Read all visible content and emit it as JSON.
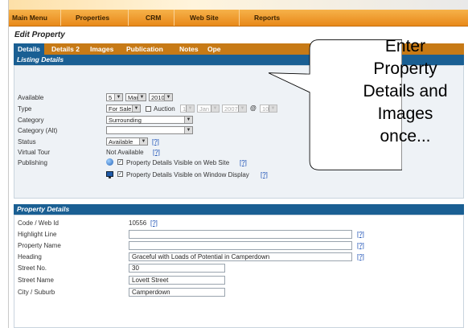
{
  "nav": {
    "items": [
      "Main Menu",
      "Properties",
      "CRM",
      "Web Site",
      "Reports"
    ]
  },
  "page_title": "Edit Property",
  "tabs": [
    "Details",
    "Details 2",
    "Images",
    "Publication",
    "Notes",
    "Ope"
  ],
  "active_tab": "Details",
  "listing": {
    "heading": "Listing Details",
    "available_label": "Available",
    "available_day": "5",
    "available_month": "Mar",
    "available_year": "2010",
    "type_label": "Type",
    "type_value": "For Sale",
    "auction_label": "Auction",
    "auction_day": "1",
    "auction_month": "Jan",
    "auction_year": "2007",
    "at_label": "@",
    "auction_hour": "10",
    "category_label": "Category",
    "category_value": "Surrounding",
    "category_alt_label": "Category (Alt)",
    "category_alt_value": "",
    "status_label": "Status",
    "status_value": "Available",
    "help": "[?]",
    "virtual_tour_label": "Virtual Tour",
    "virtual_tour_value": "Not Available",
    "publishing_label": "Publishing",
    "publish_web": "Property Details Visible on Web Site",
    "publish_window": "Property Details Visible on Window Display"
  },
  "property": {
    "heading": "Property Details",
    "code_label": "Code / Web Id",
    "code_value": "10556",
    "highlight_label": "Highlight Line",
    "highlight_value": "",
    "name_label": "Property Name",
    "name_value": "",
    "heading_label": "Heading",
    "heading_value": "Graceful with Loads of Potential in Camperdown",
    "street_no_label": "Street No.",
    "street_no_value": "30",
    "street_name_label": "Street Name",
    "street_name_value": "Lovett Street",
    "city_label": "City / Suburb",
    "city_value": "Camperdown"
  },
  "callout": {
    "lines": [
      "Enter",
      "Property",
      "Details and",
      "Images",
      "once..."
    ]
  }
}
